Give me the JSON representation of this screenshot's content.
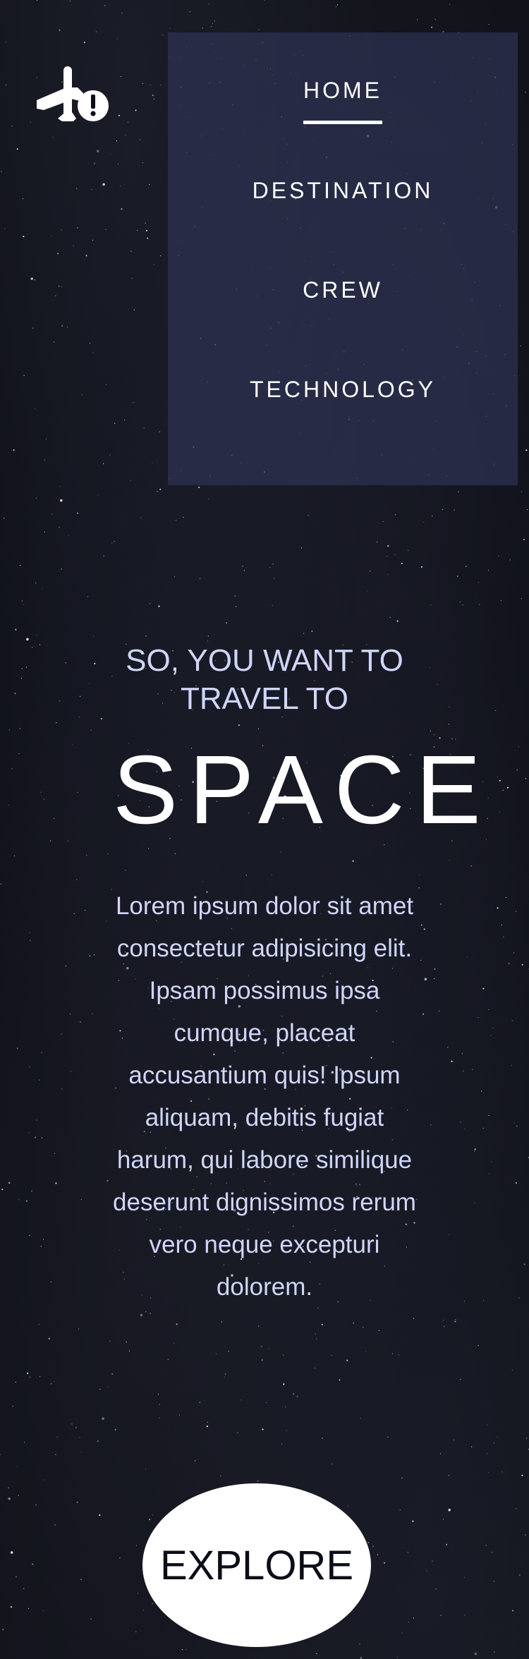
{
  "header": {
    "logo_icon": "plane-alert-icon"
  },
  "nav": {
    "items": [
      {
        "label": "HOME",
        "active": true
      },
      {
        "label": "DESTINATION",
        "active": false
      },
      {
        "label": "CREW",
        "active": false
      },
      {
        "label": "TECHNOLOGY",
        "active": false
      }
    ]
  },
  "hero": {
    "tagline": "SO, YOU WANT TO TRAVEL TO",
    "title": "SPACE",
    "description": "Lorem ipsum dolor sit amet consectetur adipisicing elit. Ipsam possimus ipsa cumque, placeat accusantium quis! Ipsum aliquam, debitis fugiat harum, qui labore similique deserunt dignissimos rerum vero neque excepturi dolorem.",
    "cta_label": "EXPLORE"
  },
  "colors": {
    "background": "#0b0d17",
    "nav_panel": "#2e3252",
    "text_primary": "#ffffff",
    "text_secondary": "#d0d6f9"
  }
}
